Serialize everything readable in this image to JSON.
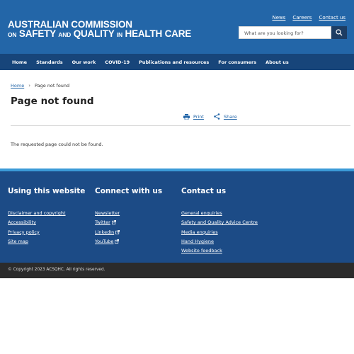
{
  "header": {
    "logo_line1": "AUSTRALIAN COMMISSION",
    "logo_line2_on": "ON",
    "logo_line2_a": "SAFETY",
    "logo_line2_and": "AND",
    "logo_line2_b": "QUALITY",
    "logo_line2_in": "IN",
    "logo_line2_c": "HEALTH CARE",
    "top_links": [
      "News",
      "Careers",
      "Contact us"
    ],
    "search_placeholder": "What are you looking for?"
  },
  "nav": {
    "items": [
      "Home",
      "Standards",
      "Our work",
      "COVID-19",
      "Publications and resources",
      "For consumers",
      "About us"
    ]
  },
  "breadcrumb": {
    "home": "Home",
    "current": "Page not found"
  },
  "main": {
    "title": "Page not found",
    "print_label": "Print",
    "share_label": "Share",
    "message": "The requested page could not be found."
  },
  "footer": {
    "col1": {
      "heading": "Using this website",
      "links": [
        "Disclaimer and copyright",
        "Accessibility",
        "Privacy policy",
        "Site map"
      ]
    },
    "col2": {
      "heading": "Connect with us",
      "links": [
        "Newsletter",
        "Twitter",
        "LinkedIn",
        "YouTube"
      ]
    },
    "col3": {
      "heading": "Contact us",
      "links": [
        "General enquiries",
        "Safety and Quality Advice Centre",
        "Media enquiries",
        "Hand Hygiene",
        "Website feedback"
      ]
    },
    "copyright": "© Copyright 2023 ACSQHC. All rights reserved."
  },
  "colors": {
    "header": "#2366a8",
    "nav": "#17457a",
    "footer": "#1c4b86",
    "link": "#2366a8"
  }
}
